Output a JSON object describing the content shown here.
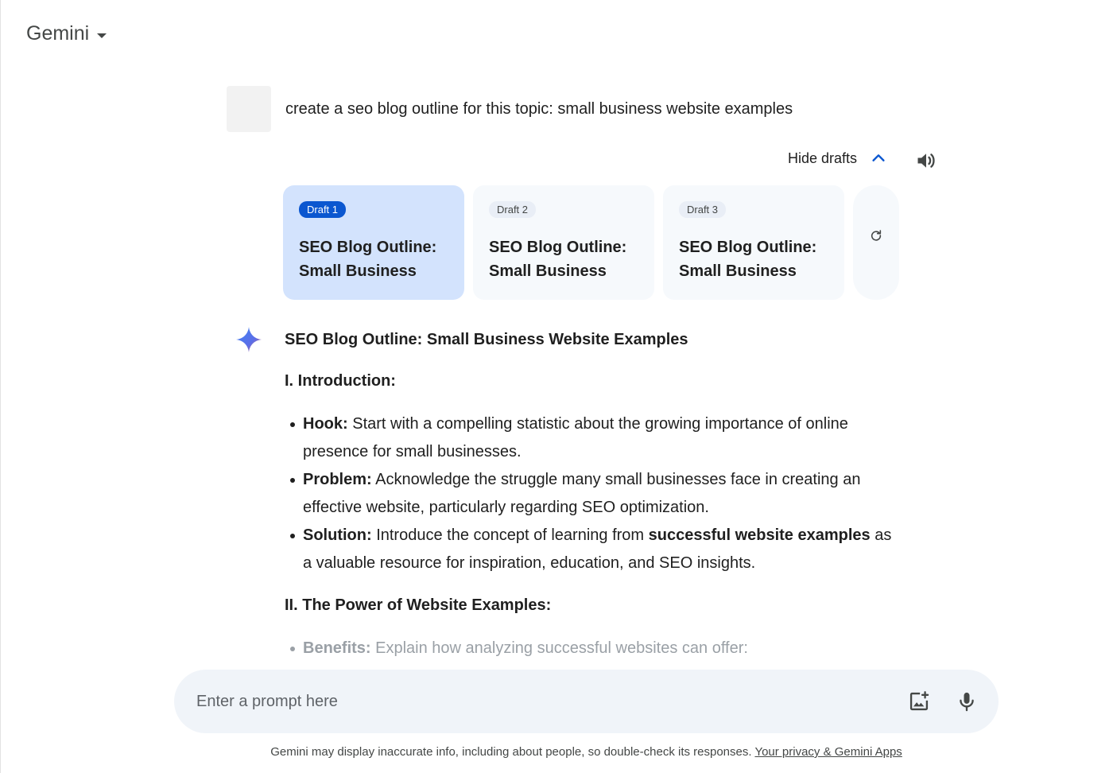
{
  "header": {
    "app_name": "Gemini"
  },
  "user_prompt": {
    "text": "create a seo blog outline for this topic: small business website examples"
  },
  "drafts_controls": {
    "hide_label": "Hide drafts"
  },
  "drafts": [
    {
      "chip": "Draft 1",
      "title_line1": "SEO Blog Outline:",
      "title_line2": "Small Business",
      "active": true
    },
    {
      "chip": "Draft 2",
      "title_line1": "SEO Blog Outline:",
      "title_line2": "Small Business",
      "active": false
    },
    {
      "chip": "Draft 3",
      "title_line1": "SEO Blog Outline:",
      "title_line2": "Small Business",
      "active": false
    }
  ],
  "response": {
    "title": "SEO Blog Outline: Small Business Website Examples",
    "section1": {
      "heading": "I. Introduction:",
      "items": [
        {
          "label": "Hook:",
          "text": " Start with a compelling statistic about the growing importance of online presence for small businesses."
        },
        {
          "label": "Problem:",
          "text": " Acknowledge the struggle many small businesses face in creating an effective website, particularly regarding SEO optimization."
        },
        {
          "label": "Solution:",
          "text_before": " Introduce the concept of learning from ",
          "emphasis": "successful website examples",
          "text_after": " as a valuable resource for inspiration, education, and SEO insights."
        }
      ]
    },
    "section2": {
      "heading": "II. The Power of Website Examples:",
      "items": [
        {
          "label": "Benefits:",
          "text": " Explain how analyzing successful websites can offer:"
        }
      ]
    }
  },
  "input": {
    "placeholder": "Enter a prompt here"
  },
  "footer": {
    "disclaimer": "Gemini may display inaccurate info, including about people, so double-check its responses. ",
    "privacy_link": "Your privacy & Gemini Apps"
  },
  "colors": {
    "accent": "#0b57d0",
    "active_draft_bg": "#d3e3fd",
    "input_bg": "#f0f4f9"
  }
}
